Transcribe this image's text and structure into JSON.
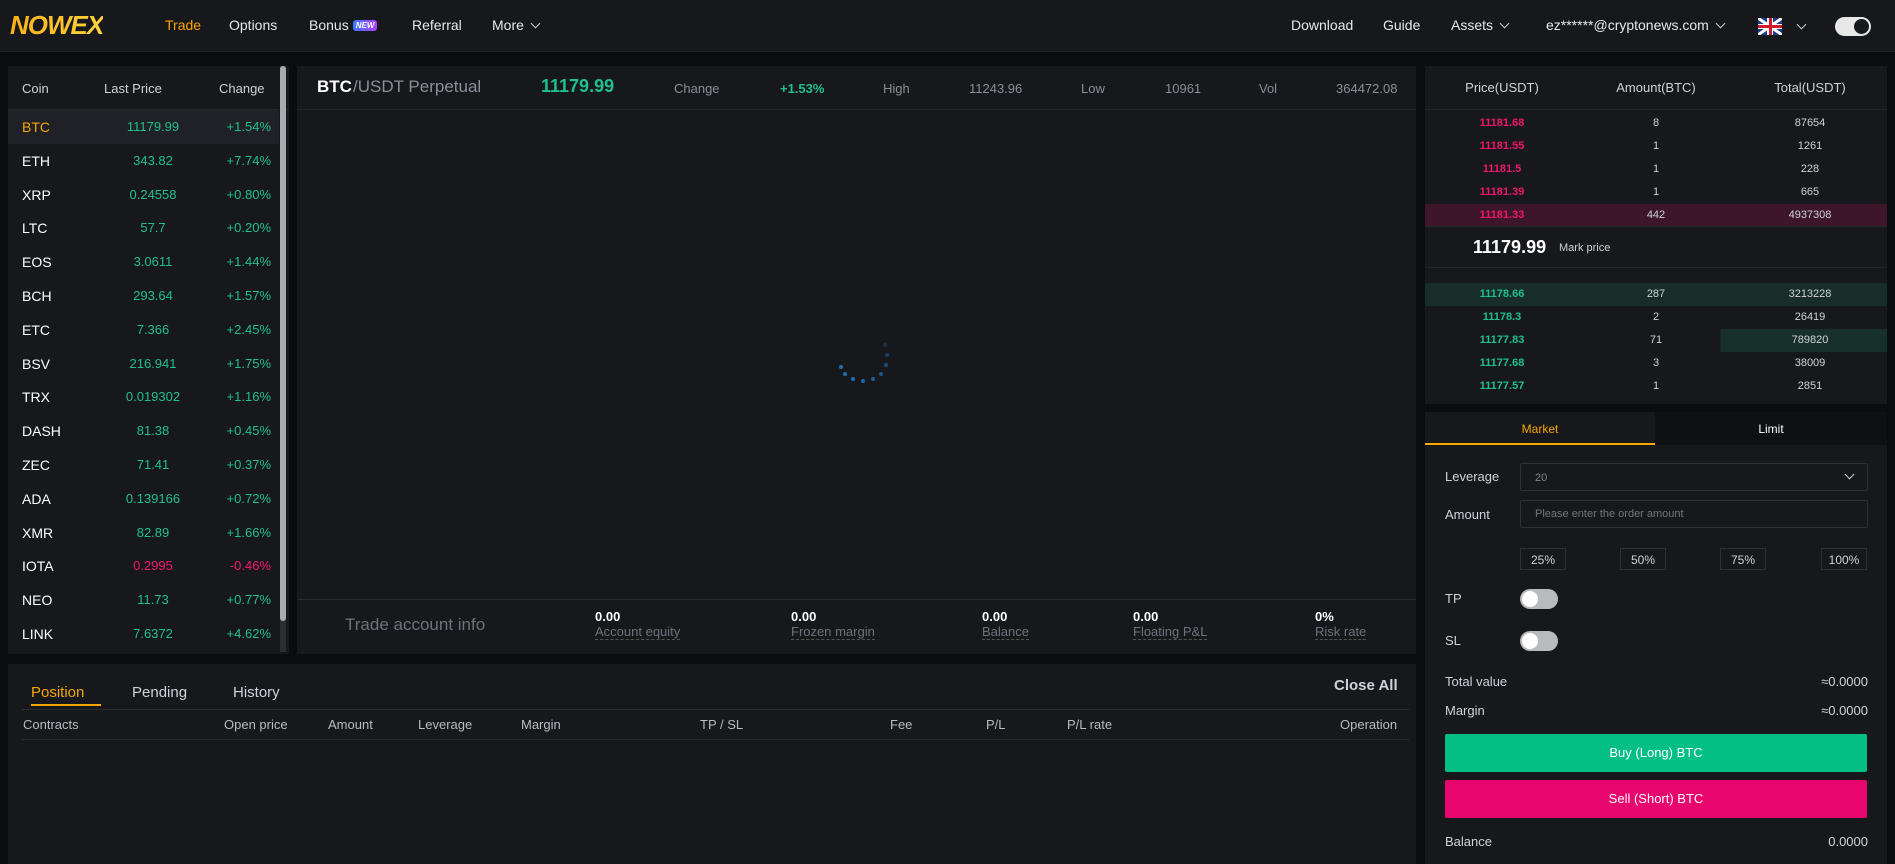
{
  "nav": {
    "logo": "NOWEX",
    "items": [
      "Trade",
      "Options",
      "Bonus",
      "Referral",
      "More"
    ],
    "bonus_badge": "NEW",
    "right": [
      "Download",
      "Guide",
      "Assets"
    ],
    "email": "ez******@cryptonews.com"
  },
  "coins": {
    "headers": [
      "Coin",
      "Last Price",
      "Change"
    ],
    "rows": [
      {
        "coin": "BTC",
        "price": "11179.99",
        "change": "+1.54%"
      },
      {
        "coin": "ETH",
        "price": "343.82",
        "change": "+7.74%"
      },
      {
        "coin": "XRP",
        "price": "0.24558",
        "change": "+0.80%"
      },
      {
        "coin": "LTC",
        "price": "57.7",
        "change": "+0.20%"
      },
      {
        "coin": "EOS",
        "price": "3.0611",
        "change": "+1.44%"
      },
      {
        "coin": "BCH",
        "price": "293.64",
        "change": "+1.57%"
      },
      {
        "coin": "ETC",
        "price": "7.366",
        "change": "+2.45%"
      },
      {
        "coin": "BSV",
        "price": "216.941",
        "change": "+1.75%"
      },
      {
        "coin": "TRX",
        "price": "0.019302",
        "change": "+1.16%"
      },
      {
        "coin": "DASH",
        "price": "81.38",
        "change": "+0.45%"
      },
      {
        "coin": "ZEC",
        "price": "71.41",
        "change": "+0.37%"
      },
      {
        "coin": "ADA",
        "price": "0.139166",
        "change": "+0.72%"
      },
      {
        "coin": "XMR",
        "price": "82.89",
        "change": "+1.66%"
      },
      {
        "coin": "IOTA",
        "price": "0.2995",
        "change": "-0.46%"
      },
      {
        "coin": "NEO",
        "price": "11.73",
        "change": "+0.77%"
      },
      {
        "coin": "LINK",
        "price": "7.6372",
        "change": "+4.62%"
      }
    ]
  },
  "ticker": {
    "base": "BTC",
    "quote": "/USDT Perpetual",
    "price": "11179.99",
    "change_label": "Change",
    "change": "+1.53%",
    "high_label": "High",
    "high": "11243.96",
    "low_label": "Low",
    "low": "10961",
    "vol_label": "Vol",
    "vol": "364472.08"
  },
  "account": {
    "title": "Trade account info",
    "items": [
      {
        "value": "0.00",
        "label": "Account equity"
      },
      {
        "value": "0.00",
        "label": "Frozen margin"
      },
      {
        "value": "0.00",
        "label": "Balance"
      },
      {
        "value": "0.00",
        "label": "Floating P&L"
      },
      {
        "value": "0%",
        "label": "Risk rate"
      }
    ]
  },
  "orderbook": {
    "headers": [
      "Price(USDT)",
      "Amount(BTC)",
      "Total(USDT)"
    ],
    "asks": [
      {
        "price": "11181.68",
        "amount": "8",
        "total": "87654"
      },
      {
        "price": "11181.55",
        "amount": "1",
        "total": "1261"
      },
      {
        "price": "11181.5",
        "amount": "1",
        "total": "228"
      },
      {
        "price": "11181.39",
        "amount": "1",
        "total": "665"
      },
      {
        "price": "11181.33",
        "amount": "442",
        "total": "4937308"
      }
    ],
    "mark_price": "11179.99",
    "mark_label": "Mark price",
    "bids": [
      {
        "price": "11178.66",
        "amount": "287",
        "total": "3213228"
      },
      {
        "price": "11178.3",
        "amount": "2",
        "total": "26419"
      },
      {
        "price": "11177.83",
        "amount": "71",
        "total": "789820"
      },
      {
        "price": "11177.68",
        "amount": "3",
        "total": "38009"
      },
      {
        "price": "11177.57",
        "amount": "1",
        "total": "2851"
      }
    ]
  },
  "form": {
    "tabs": [
      "Market",
      "Limit"
    ],
    "leverage_label": "Leverage",
    "leverage_value": "20",
    "amount_label": "Amount",
    "amount_placeholder": "Please enter the order amount",
    "percents": [
      "25%",
      "50%",
      "75%",
      "100%"
    ],
    "tp_label": "TP",
    "sl_label": "SL",
    "total_label": "Total value",
    "total_value": "≈0.0000",
    "margin_label": "Margin",
    "margin_value": "≈0.0000",
    "buy_label": "Buy (Long) BTC",
    "sell_label": "Sell (Short) BTC",
    "balance_label": "Balance",
    "balance_value": "0.0000"
  },
  "positions": {
    "tabs": [
      "Position",
      "Pending",
      "History"
    ],
    "close_all": "Close All",
    "columns": [
      "Contracts",
      "Open price",
      "Amount",
      "Leverage",
      "Margin",
      "TP / SL",
      "Fee",
      "P/L",
      "P/L rate",
      "Operation"
    ]
  },
  "colors": {
    "accent": "#f7a600",
    "green": "#1fc08a",
    "red": "#f0166a",
    "buy": "#03bf84",
    "sell": "#e7066e"
  }
}
